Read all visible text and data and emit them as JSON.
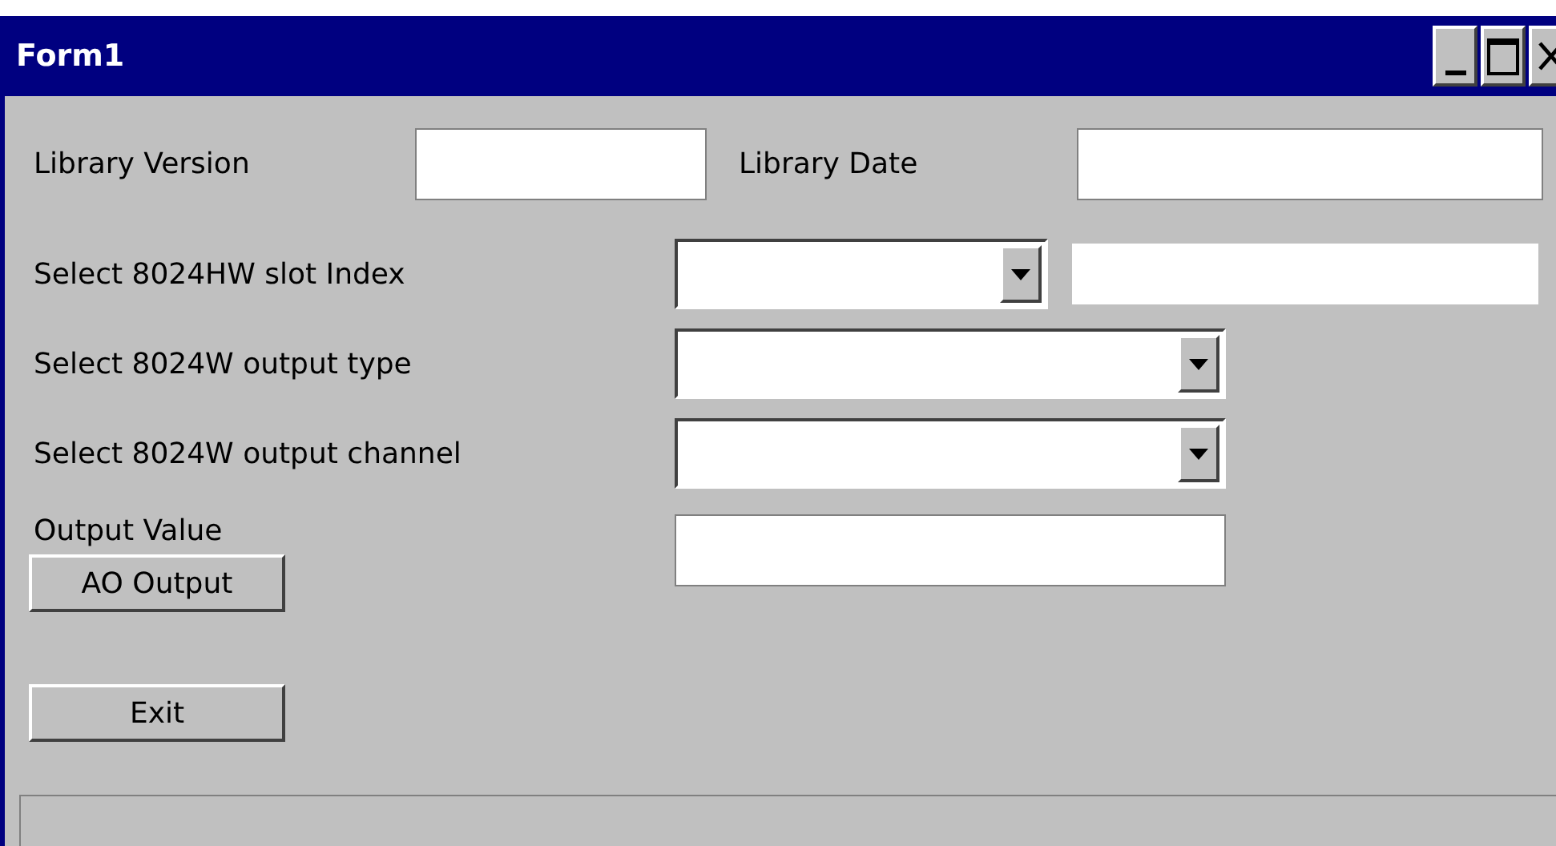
{
  "window": {
    "title": "Form1"
  },
  "library": [
    {
      "label": "Library Version"
    },
    {
      "label": "Library Date"
    }
  ],
  "selects": [
    {
      "label": "Select 8024HW slot Index",
      "kind": "with_display"
    },
    {
      "label": "Select 8024W output type",
      "kind": "wide"
    },
    {
      "label": "Select 8024W output channel",
      "kind": "wide"
    }
  ],
  "output_value": {
    "label": "Output Value"
  },
  "buttons": [
    {
      "label": "AO Output"
    },
    {
      "label": "Exit"
    }
  ]
}
